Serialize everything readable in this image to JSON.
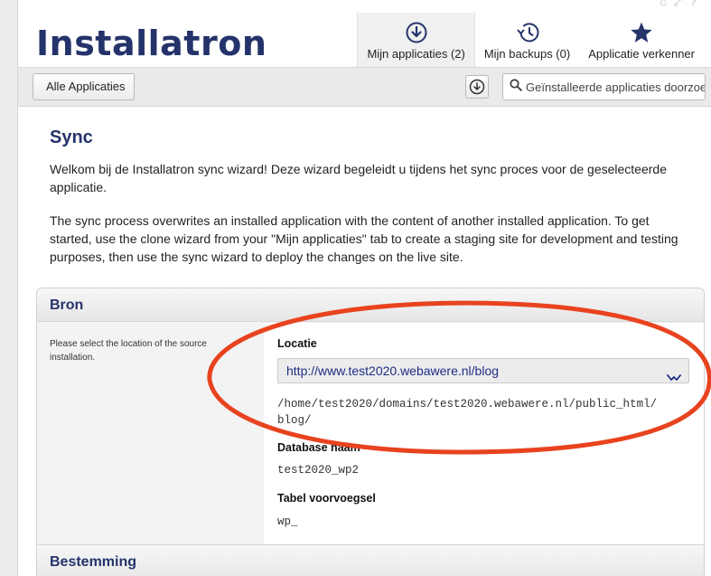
{
  "header": {
    "logo": "Installatron",
    "tabs": [
      {
        "label": "Mijn applicaties (2)",
        "icon": "download-circle-icon",
        "active": true
      },
      {
        "label": "Mijn backups (0)",
        "icon": "history-clock-icon",
        "active": false
      },
      {
        "label": "Applicatie verkenner",
        "icon": "star-icon",
        "active": false
      }
    ],
    "corner_icons": "⌂ ⤢ ?"
  },
  "toolbar": {
    "back_label": "Alle Applicaties",
    "search_placeholder": "Geïnstalleerde applicaties doorzoeken"
  },
  "main": {
    "title": "Sync",
    "intro1": "Welkom bij de Installatron sync wizard! Deze wizard begeleidt u tijdens het sync proces voor de geselecteerde applicatie.",
    "intro2": "The sync process overwrites an installed application with the content of another installed application. To get started, use the clone wizard from your \"Mijn applicaties\" tab to create a staging site for development and testing purposes, then use the sync wizard to deploy the changes on the live site."
  },
  "source": {
    "heading": "Bron",
    "help": "Please select the location of the source installation.",
    "location_label": "Locatie",
    "location_value": "http://www.test2020.webawere.nl/blog",
    "path_line1": "/home/test2020/domains/test2020.webawere.nl/public_html/",
    "path_line2": "blog/",
    "db_label": "Database naam",
    "db_value": "test2020_wp2",
    "prefix_label": "Tabel voorvoegsel",
    "prefix_value": "wp_"
  },
  "destination": {
    "heading": "Bestemming"
  },
  "colors": {
    "brand": "#25336b",
    "link": "#1d2e83",
    "annotation": "#e8431f"
  }
}
